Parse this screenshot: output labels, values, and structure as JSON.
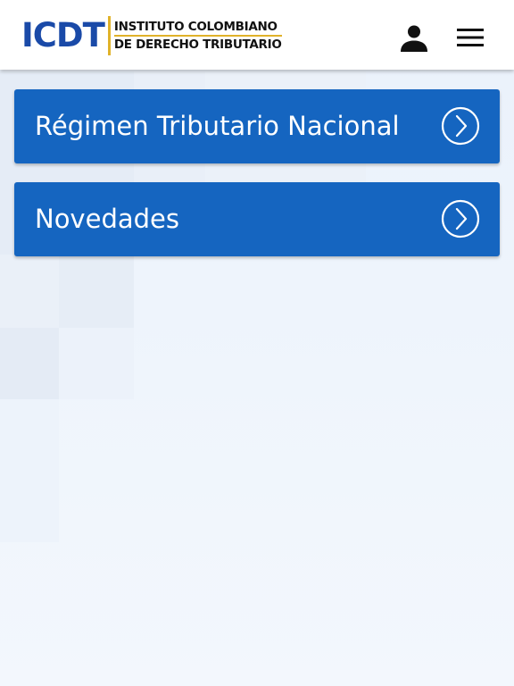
{
  "header": {
    "logo": {
      "mark": "ICDT",
      "line1": "INSTITUTO COLOMBIANO",
      "line2": "DE DERECHO TRIBUTARIO"
    },
    "icons": {
      "user": "user-icon",
      "menu": "hamburger-menu-icon"
    }
  },
  "menu": {
    "items": [
      {
        "label": "Régimen Tributario Nacional",
        "icon": "chevron-right-circle-icon"
      },
      {
        "label": "Novedades",
        "icon": "chevron-right-circle-icon"
      }
    ]
  },
  "colors": {
    "primary": "#1565c0",
    "logo_blue": "#1a4aa8",
    "logo_gold": "#e0b229",
    "header_bg": "#ffffff",
    "page_bg": "#edf3fb"
  }
}
